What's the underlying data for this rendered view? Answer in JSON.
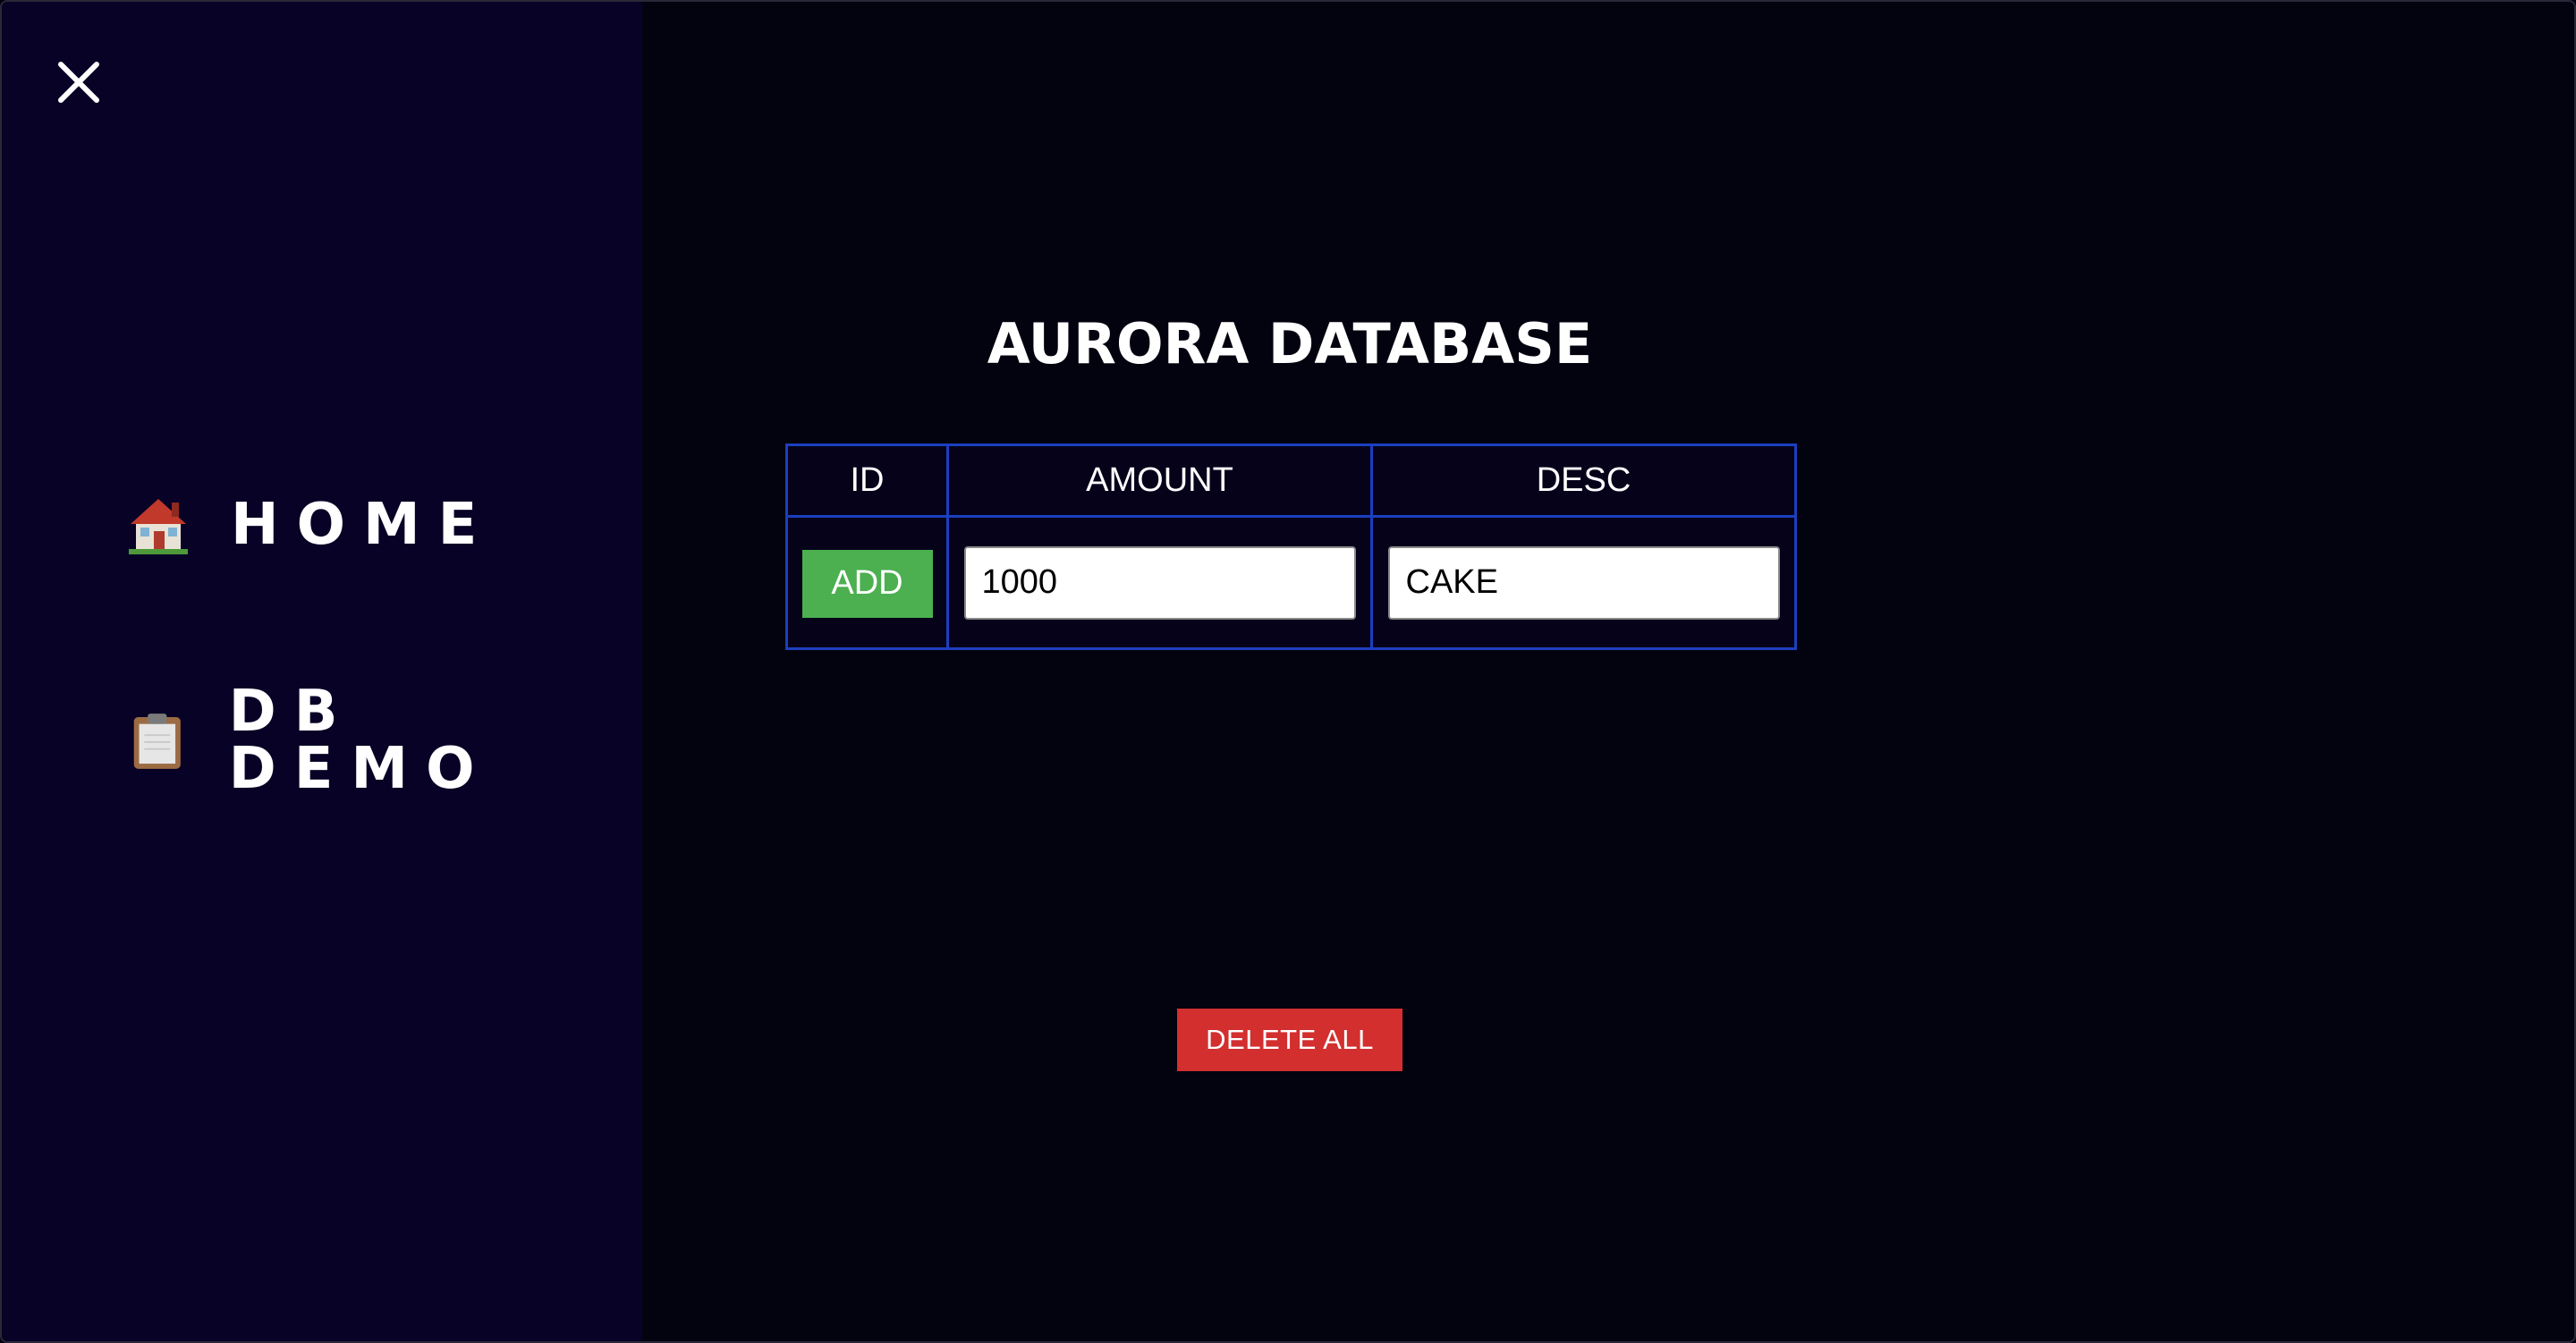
{
  "sidebar": {
    "close_icon": "close-icon",
    "items": [
      {
        "label": "HOME",
        "icon": "house-icon"
      },
      {
        "label": "DB DEMO",
        "icon": "clipboard-icon"
      }
    ]
  },
  "main": {
    "title": "AURORA DATABASE",
    "table": {
      "headers": [
        "ID",
        "AMOUNT",
        "DESC"
      ],
      "add_label": "ADD",
      "amount_value": "1000",
      "desc_value": "CAKE"
    },
    "delete_all_label": "DELETE ALL"
  },
  "colors": {
    "sidebar_bg": "#070226",
    "page_bg": "#03020f",
    "table_border": "#1b3fbf",
    "add_button": "#4caf50",
    "delete_button": "#d32f2f"
  }
}
